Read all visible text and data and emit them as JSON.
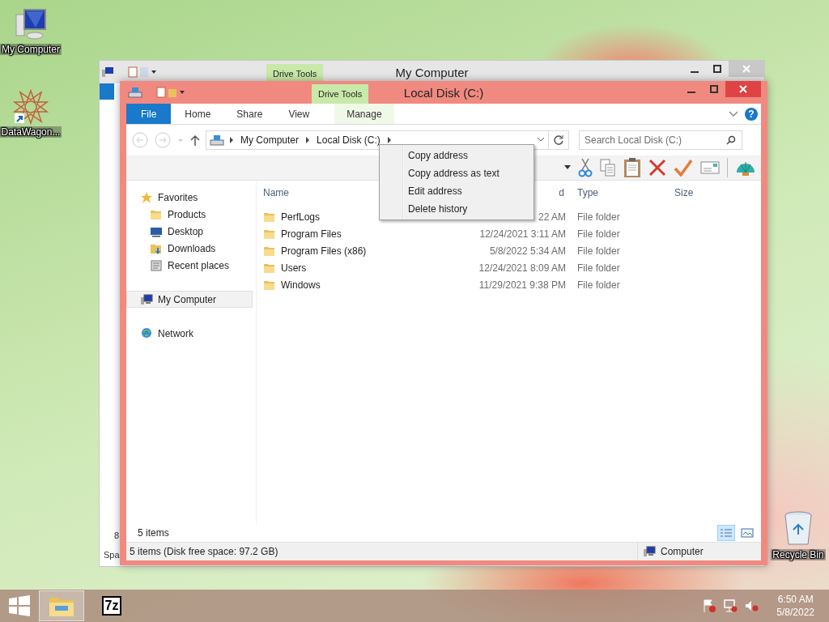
{
  "desktop_icons": [
    {
      "label": "My Computer",
      "kind": "computer"
    },
    {
      "label": "DataWagon...",
      "kind": "shortcut"
    },
    {
      "label": "Recycle Bin",
      "kind": "recycle"
    }
  ],
  "back_window": {
    "title": "My Computer",
    "context_tab": "Drive Tools",
    "status_fragments": [
      "8",
      "Spa"
    ]
  },
  "window": {
    "title": "Local Disk (C:)",
    "context_tab": "Drive Tools",
    "ribbon_tabs": [
      {
        "label": "File",
        "kind": "file",
        "selected": false
      },
      {
        "label": "Home",
        "kind": "tab",
        "selected": false
      },
      {
        "label": "Share",
        "kind": "tab",
        "selected": false
      },
      {
        "label": "View",
        "kind": "tab",
        "selected": false
      },
      {
        "label": "Manage",
        "kind": "context",
        "selected": false
      }
    ],
    "help_glyph": "?",
    "breadcrumb": [
      "My Computer",
      "Local Disk (C:)"
    ],
    "search": {
      "placeholder": "Search Local Disk (C:)"
    },
    "nav": [
      {
        "label": "Favorites",
        "kind": "star",
        "selected": false,
        "children": [
          {
            "label": "Products",
            "kind": "folder",
            "selected": false
          },
          {
            "label": "Desktop",
            "kind": "desktop",
            "selected": false
          },
          {
            "label": "Downloads",
            "kind": "downloads",
            "selected": false
          },
          {
            "label": "Recent places",
            "kind": "recent",
            "selected": false
          }
        ]
      },
      {
        "label": "My Computer",
        "kind": "computer",
        "selected": true
      },
      {
        "label": "Network",
        "kind": "network",
        "selected": false
      }
    ],
    "columns": [
      "Name",
      "d",
      "Type",
      "Size"
    ],
    "rows": [
      {
        "name": "PerfLogs",
        "date": "22 AM",
        "type": "File folder"
      },
      {
        "name": "Program Files",
        "date": "12/24/2021 3:11 AM",
        "type": "File folder"
      },
      {
        "name": "Program Files (x86)",
        "date": "5/8/2022 5:34 AM",
        "type": "File folder"
      },
      {
        "name": "Users",
        "date": "12/24/2021 8:09 AM",
        "type": "File folder"
      },
      {
        "name": "Windows",
        "date": "11/29/2021 9:38 PM",
        "type": "File folder"
      }
    ],
    "item_count": "5 items",
    "views": [
      {
        "kind": "details",
        "selected": true
      },
      {
        "kind": "tiles",
        "selected": false
      }
    ],
    "status_bar": {
      "text": "5 items (Disk free space: 97.2 GB)",
      "location": "Computer"
    }
  },
  "context_menu": [
    "Copy address",
    "Copy address as text",
    "Edit address",
    "Delete history"
  ],
  "taskbar": {
    "apps": [
      {
        "kind": "explorer",
        "active": true
      },
      {
        "kind": "sevenzip",
        "label": "7z",
        "active": false
      }
    ],
    "time": "6:50 AM",
    "date": "5/8/2022"
  }
}
